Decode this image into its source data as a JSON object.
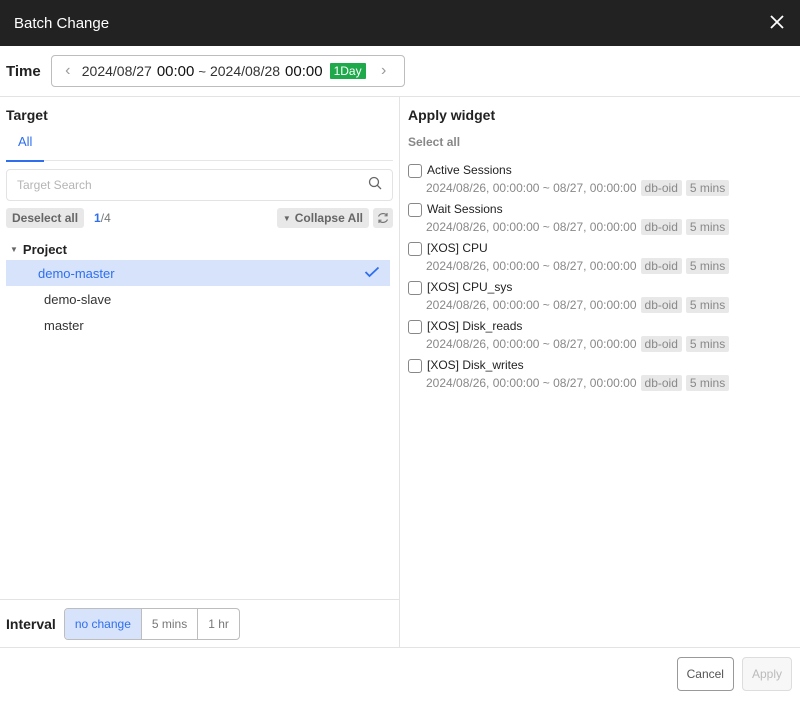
{
  "header": {
    "title": "Batch Change"
  },
  "time": {
    "label": "Time",
    "start_date": "2024/08/27",
    "start_time": "00:00",
    "separator": "~",
    "end_date": "2024/08/28",
    "end_time": "00:00",
    "range_badge": "1Day",
    "badge_color": "#1ea94b"
  },
  "target": {
    "title": "Target",
    "tabs": [
      {
        "label": "All",
        "active": true
      }
    ],
    "search_placeholder": "Target Search",
    "deselect_label": "Deselect all",
    "count_selected": "1",
    "count_total": "/4",
    "collapse_label": "Collapse All",
    "tree": {
      "group": "Project",
      "items": [
        {
          "label": "demo-master",
          "selected": true
        },
        {
          "label": "demo-slave",
          "selected": false
        },
        {
          "label": "master",
          "selected": false
        }
      ]
    }
  },
  "interval": {
    "label": "Interval",
    "options": [
      {
        "label": "no change",
        "active": true
      },
      {
        "label": "5 mins",
        "active": false
      },
      {
        "label": "1 hr",
        "active": false
      }
    ]
  },
  "apply_widget": {
    "title": "Apply widget",
    "select_all": "Select all",
    "widgets": [
      {
        "name": "Active Sessions",
        "range": "2024/08/26, 00:00:00 ~ 08/27, 00:00:00",
        "tag1": "db-oid",
        "tag2": "5 mins"
      },
      {
        "name": "Wait Sessions",
        "range": "2024/08/26, 00:00:00 ~ 08/27, 00:00:00",
        "tag1": "db-oid",
        "tag2": "5 mins"
      },
      {
        "name": "[XOS] CPU",
        "range": "2024/08/26, 00:00:00 ~ 08/27, 00:00:00",
        "tag1": "db-oid",
        "tag2": "5 mins"
      },
      {
        "name": "[XOS] CPU_sys",
        "range": "2024/08/26, 00:00:00 ~ 08/27, 00:00:00",
        "tag1": "db-oid",
        "tag2": "5 mins"
      },
      {
        "name": "[XOS] Disk_reads",
        "range": "2024/08/26, 00:00:00 ~ 08/27, 00:00:00",
        "tag1": "db-oid",
        "tag2": "5 mins"
      },
      {
        "name": "[XOS] Disk_writes",
        "range": "2024/08/26, 00:00:00 ~ 08/27, 00:00:00",
        "tag1": "db-oid",
        "tag2": "5 mins"
      }
    ]
  },
  "footer": {
    "cancel_label": "Cancel",
    "apply_label": "Apply"
  }
}
